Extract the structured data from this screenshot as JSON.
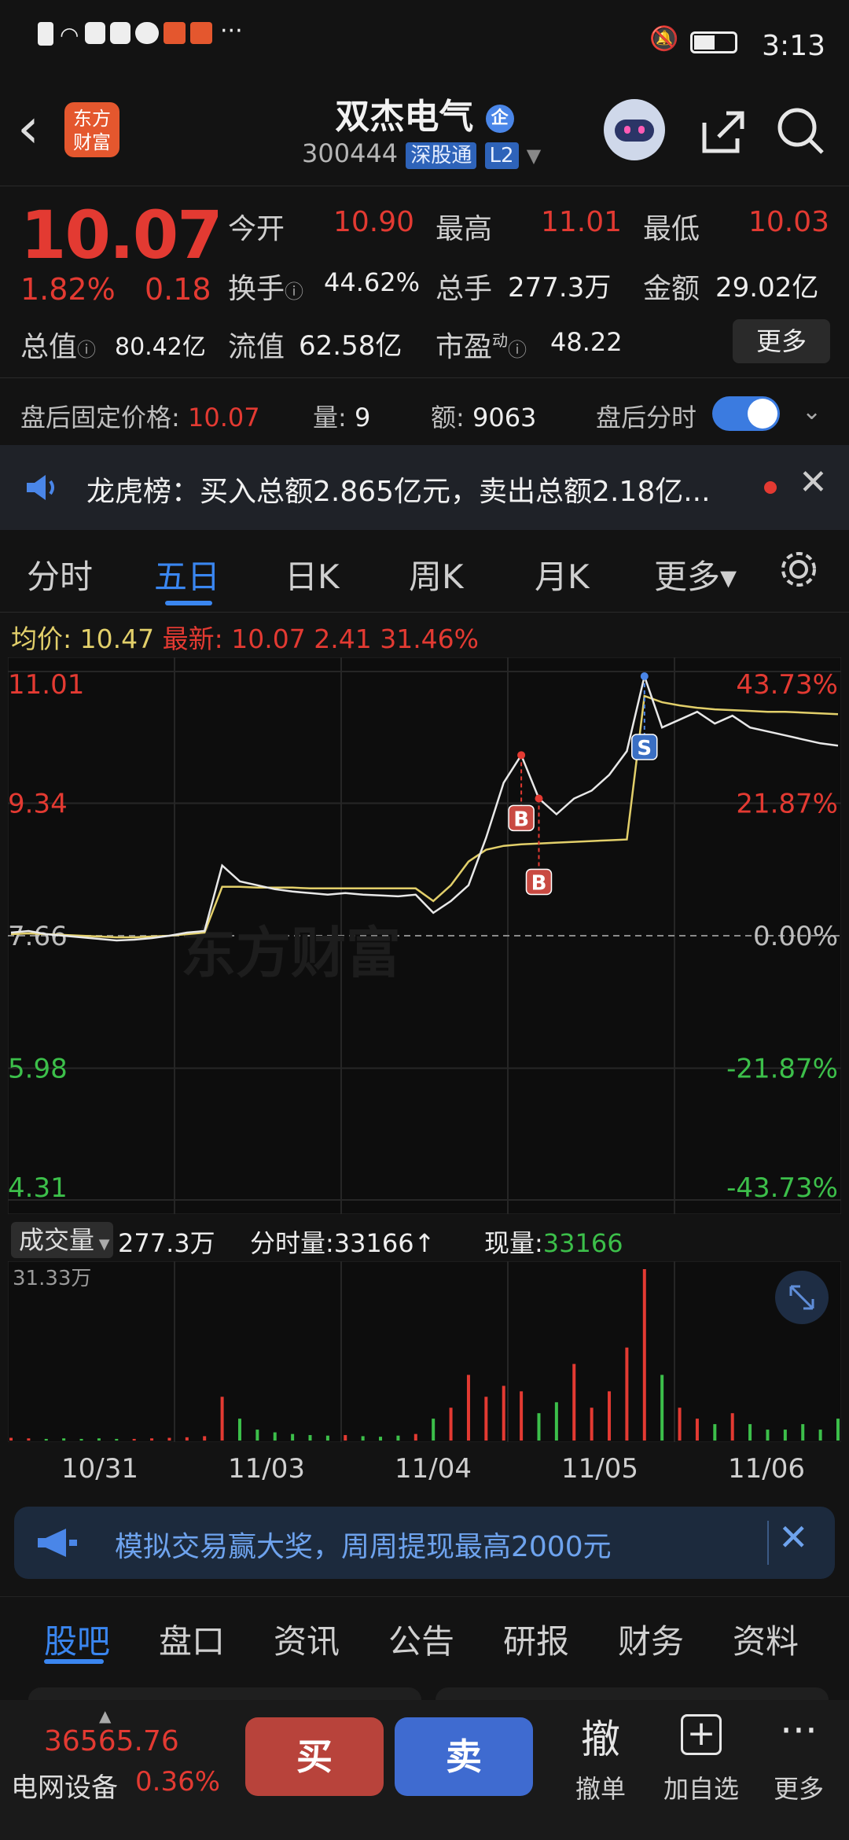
{
  "status_bar": {
    "time": "3:13",
    "battery_icon": "battery-icon",
    "mute_icon": "bell-off-icon"
  },
  "header": {
    "title": "双杰电气",
    "badge": "企",
    "code": "300444",
    "tag1": "深股通",
    "tag2": "L2",
    "logo_text_line1": "东方",
    "logo_text_line2": "财富"
  },
  "quote": {
    "price": "10.07",
    "pct": "1.82%",
    "change": "0.18",
    "open_label": "今开",
    "open_value": "10.90",
    "high_label": "最高",
    "high_value": "11.01",
    "low_label": "最低",
    "low_value": "10.03",
    "turnover_label": "换手",
    "turnover_value": "44.62%",
    "volume_label": "总手",
    "volume_value": "277.3万",
    "amount_label": "金额",
    "amount_value": "29.02亿",
    "mktcap_label": "总值",
    "mktcap_value": "80.42亿",
    "float_label": "流值",
    "float_value": "62.58亿",
    "pe_label": "市盈",
    "pe_sup": "动",
    "pe_value": "48.22",
    "more_label": "更多"
  },
  "after_hours": {
    "price_label": "盘后固定价格:",
    "price_value": "10.07",
    "qty_label": "量:",
    "qty_value": "9",
    "amt_label": "额:",
    "amt_value": "9063",
    "toggle_label": "盘后分时",
    "toggle_on": true
  },
  "notice": {
    "text": "龙虎榜：买入总额2.865亿元，卖出总额2.18亿..."
  },
  "tabs": [
    "分时",
    "五日",
    "日K",
    "周K",
    "月K",
    "更多▾"
  ],
  "active_tab": "五日",
  "summary": {
    "avg_label": "均价:",
    "avg_value": "10.47",
    "latest_label": "最新:",
    "latest_value": "10.07",
    "latest_change": "2.41",
    "latest_pct": "31.46%"
  },
  "chart_data": {
    "type": "line",
    "title": "",
    "xlabel": "",
    "ylabel": "",
    "y_ticks_left": [
      "11.01",
      "9.34",
      "7.66",
      "5.98",
      "4.31"
    ],
    "y_ticks_right": [
      "43.73%",
      "21.87%",
      "0.00%",
      "-21.87%",
      "-43.73%"
    ],
    "ylim": [
      4.31,
      11.01
    ],
    "prev_close": 7.66,
    "x_categories": [
      "10/31",
      "11/03",
      "11/04",
      "11/05",
      "11/06"
    ],
    "series": [
      {
        "values": [
          7.7,
          7.72,
          7.68,
          7.66,
          7.64,
          7.62,
          7.6,
          7.61,
          7.63,
          7.66,
          7.7,
          7.72,
          8.55,
          8.35,
          8.3,
          8.25,
          8.22,
          8.2,
          8.18,
          8.2,
          8.18,
          8.17,
          8.16,
          8.18,
          7.95,
          8.1,
          8.3,
          8.9,
          9.6,
          9.95,
          9.4,
          9.2,
          9.4,
          9.5,
          9.7,
          10.0,
          10.95,
          10.3,
          10.4,
          10.5,
          10.35,
          10.45,
          10.3,
          10.25,
          10.2,
          10.15,
          10.1,
          10.07
        ]
      },
      {
        "values": [
          7.68,
          7.69,
          7.68,
          7.67,
          7.66,
          7.65,
          7.64,
          7.64,
          7.65,
          7.66,
          7.68,
          7.7,
          8.28,
          8.28,
          8.27,
          8.27,
          8.27,
          8.26,
          8.26,
          8.26,
          8.26,
          8.26,
          8.26,
          8.26,
          8.1,
          8.3,
          8.6,
          8.75,
          8.8,
          8.82,
          8.83,
          8.84,
          8.85,
          8.86,
          8.87,
          8.88,
          10.7,
          10.62,
          10.58,
          10.55,
          10.53,
          10.52,
          10.51,
          10.5,
          10.5,
          10.49,
          10.48,
          10.47
        ]
      }
    ],
    "markers": [
      {
        "label": "B",
        "x_index": 29
      },
      {
        "label": "B",
        "x_index": 30
      },
      {
        "label": "S",
        "x_index": 36
      }
    ],
    "volume": {
      "label": "成交量",
      "total": "277.3万",
      "tick_label": "分时量:33166↑",
      "now_label": "现量:",
      "now_value": "33166",
      "max_label": "31.33万",
      "values": [
        0.5,
        0.4,
        0.3,
        0.4,
        0.3,
        0.4,
        0.3,
        0.3,
        0.4,
        0.5,
        0.6,
        0.8,
        8,
        4,
        2,
        1.5,
        1.2,
        1,
        0.9,
        1,
        0.8,
        0.7,
        0.9,
        1.2,
        4,
        6,
        12,
        8,
        10,
        9,
        5,
        7,
        14,
        6,
        9,
        17,
        31.33,
        12,
        6,
        4,
        3,
        5,
        3,
        2,
        2,
        3,
        2,
        4
      ]
    }
  },
  "promo": {
    "text": "模拟交易赢大奖，周周提现最高2000元"
  },
  "bottom_tabs": [
    "股吧",
    "盘口",
    "资讯",
    "公告",
    "研报",
    "财务",
    "资料"
  ],
  "bottom_active": "股吧",
  "footer": {
    "index_value": "36565.76",
    "index_name": "电网设备",
    "index_pct": "0.36%",
    "buy": "买",
    "sell": "卖",
    "cancel_big": "撤",
    "cancel_label": "撤单",
    "watch_big": "+",
    "watch_label": "加自选",
    "more_big": "···",
    "more_label": "更多"
  },
  "colors": {
    "up": "#e33a32",
    "down": "#3cbf4a",
    "accent": "#3a86f0",
    "avg_line": "#e2cf6a"
  }
}
